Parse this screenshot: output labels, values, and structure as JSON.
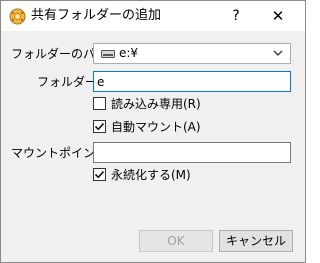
{
  "window": {
    "title": "共有フォルダーの追加",
    "help": "?",
    "close": "✕"
  },
  "form": {
    "folder_path_label": "フォルダーのパス:",
    "folder_path_value": "e:¥",
    "folder_name_label": "フォルダー名:",
    "folder_name_value": "e",
    "read_only_label": "読み込み専用(R)",
    "read_only_checked": false,
    "auto_mount_label": "自動マウント(A)",
    "auto_mount_checked": true,
    "mount_point_label": "マウントポイント:",
    "mount_point_value": "",
    "permanent_label": "永続化する(M)",
    "permanent_checked": true
  },
  "buttons": {
    "ok": "OK",
    "cancel": "キャンセル"
  },
  "colors": {
    "focus_border": "#0078d7",
    "dialog_bg": "#f0f0f0"
  }
}
